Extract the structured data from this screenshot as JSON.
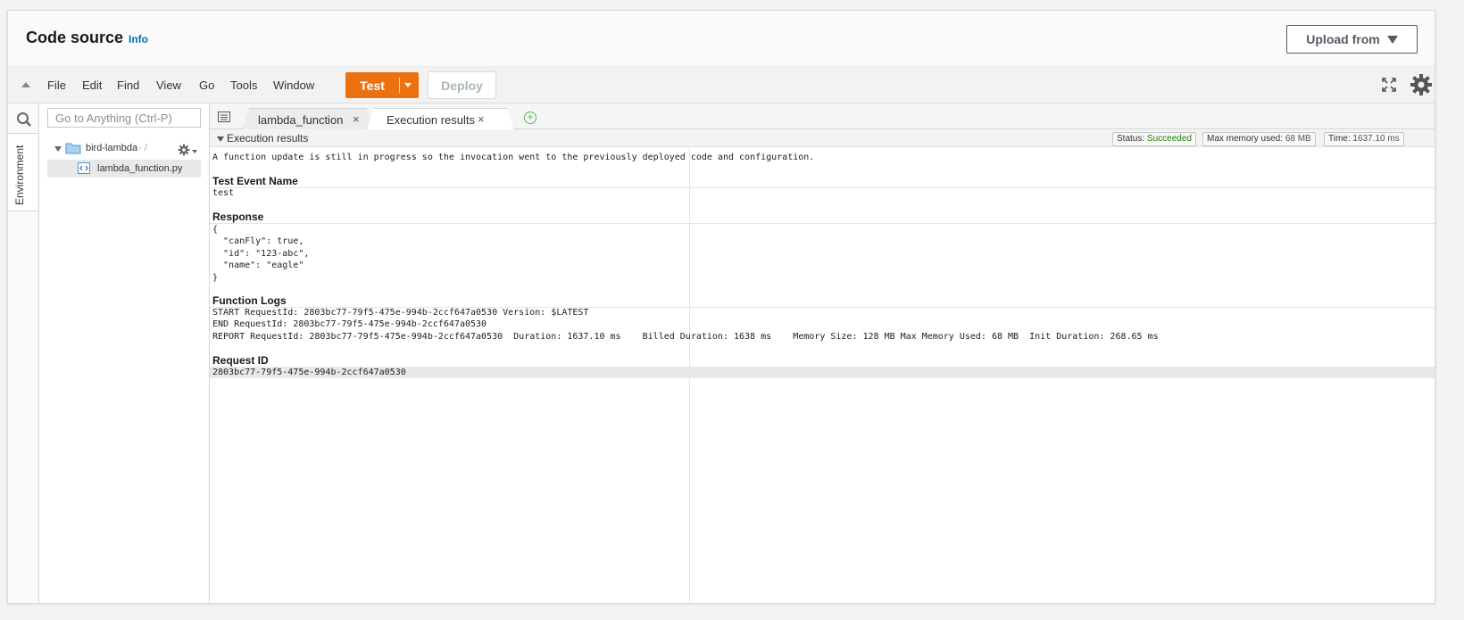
{
  "header": {
    "title": "Code source",
    "info_link": "Info",
    "upload_label": "Upload from"
  },
  "menu": {
    "items": [
      "File",
      "Edit",
      "Find",
      "View",
      "Go",
      "Tools",
      "Window"
    ],
    "test_label": "Test",
    "deploy_label": "Deploy"
  },
  "sidebar": {
    "environment_tab": "Environment",
    "search_placeholder": "Go to Anything (Ctrl-P)"
  },
  "tree": {
    "root_name": "bird-lambda",
    "root_suffix": "- /",
    "file_name": "lambda_function.py"
  },
  "tabs": [
    {
      "label": "lambda_function",
      "close": "×"
    },
    {
      "label": "Execution results",
      "close": "×"
    }
  ],
  "execution": {
    "header": "Execution results",
    "status_label": "Status:",
    "status_value": "Succeeded",
    "memory_label": "Max memory used:",
    "memory_value": "68 MB",
    "time_label": "Time:",
    "time_value": "1637.10 ms",
    "notice": "A function update is still in progress so the invocation went to the previously deployed code and configuration.",
    "test_event_heading": "Test Event Name",
    "test_event_value": "test",
    "response_heading": "Response",
    "response_lines": [
      "{",
      "  \"canFly\": true,",
      "  \"id\": \"123-abc\",",
      "  \"name\": \"eagle\"",
      "}"
    ],
    "logs_heading": "Function Logs",
    "log_lines": [
      "START RequestId: 2803bc77-79f5-475e-994b-2ccf647a0530 Version: $LATEST",
      "END RequestId: 2803bc77-79f5-475e-994b-2ccf647a0530",
      "REPORT RequestId: 2803bc77-79f5-475e-994b-2ccf647a0530  Duration: 1637.10 ms    Billed Duration: 1638 ms    Memory Size: 128 MB Max Memory Used: 68 MB  Init Duration: 268.65 ms"
    ],
    "request_id_heading": "Request ID",
    "request_id_value": "2803bc77-79f5-475e-994b-2ccf647a0530"
  },
  "colors": {
    "accent": "#ec7211",
    "link": "#0073bb",
    "success": "#1d8102"
  },
  "icons": [
    "collapse-icon",
    "fullscreen-icon",
    "settings-gear-icon",
    "search-icon",
    "folder-icon",
    "gear-icon",
    "python-file-icon",
    "tab-list-icon",
    "add-tab-icon"
  ]
}
